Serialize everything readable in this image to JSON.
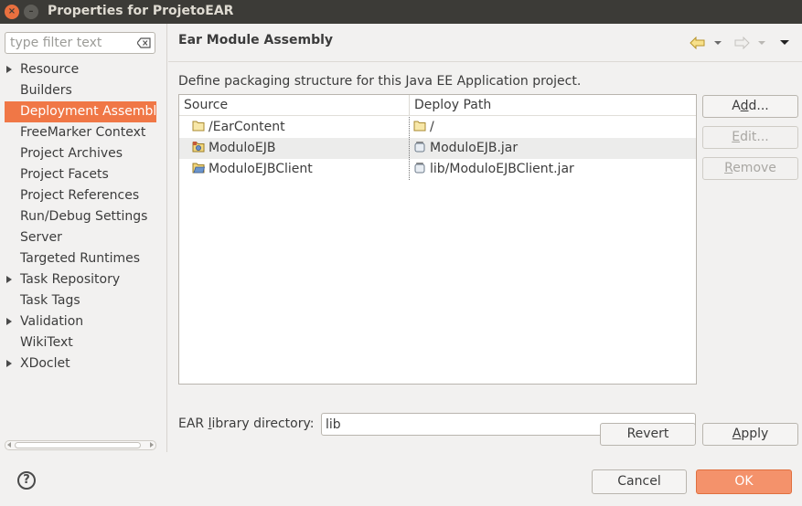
{
  "window": {
    "title": "Properties for ProjetoEAR",
    "close_glyph": "×",
    "other_glyph": "–"
  },
  "filter": {
    "placeholder": "type filter text"
  },
  "tree": [
    {
      "label": "Resource",
      "expandable": true,
      "selected": false
    },
    {
      "label": "Builders",
      "expandable": false,
      "selected": false
    },
    {
      "label": "Deployment Assembly",
      "expandable": false,
      "selected": true
    },
    {
      "label": "FreeMarker Context",
      "expandable": false,
      "selected": false
    },
    {
      "label": "Project Archives",
      "expandable": false,
      "selected": false
    },
    {
      "label": "Project Facets",
      "expandable": false,
      "selected": false
    },
    {
      "label": "Project References",
      "expandable": false,
      "selected": false
    },
    {
      "label": "Run/Debug Settings",
      "expandable": false,
      "selected": false
    },
    {
      "label": "Server",
      "expandable": false,
      "selected": false
    },
    {
      "label": "Targeted Runtimes",
      "expandable": false,
      "selected": false
    },
    {
      "label": "Task Repository",
      "expandable": true,
      "selected": false
    },
    {
      "label": "Task Tags",
      "expandable": false,
      "selected": false
    },
    {
      "label": "Validation",
      "expandable": true,
      "selected": false
    },
    {
      "label": "WikiText",
      "expandable": false,
      "selected": false
    },
    {
      "label": "XDoclet",
      "expandable": true,
      "selected": false
    }
  ],
  "page": {
    "title": "Ear Module Assembly",
    "description": "Define packaging structure for this Java EE Application project.",
    "columns": {
      "source": "Source",
      "deploy_path": "Deploy Path"
    },
    "rows": [
      {
        "source": "/EarContent",
        "source_icon": "folder-icon",
        "deploy_path": "/",
        "deploy_icon": "folder-icon"
      },
      {
        "source": "ModuloEJB",
        "source_icon": "ejb-project-icon",
        "deploy_path": "ModuloEJB.jar",
        "deploy_icon": "jar-icon"
      },
      {
        "source": "ModuloEJBClient",
        "source_icon": "project-folder-icon",
        "deploy_path": "lib/ModuloEJBClient.jar",
        "deploy_icon": "jar-icon"
      }
    ],
    "buttons": {
      "add": {
        "pre": "A",
        "mn": "d",
        "post": "d..."
      },
      "edit": {
        "pre": "",
        "mn": "E",
        "post": "dit..."
      },
      "remove": {
        "pre": "",
        "mn": "R",
        "post": "emove"
      }
    },
    "library_directory": {
      "pre": "EAR ",
      "mn": "l",
      "post": "ibrary directory:",
      "value": "lib"
    },
    "revert": "Revert",
    "apply": {
      "pre": "",
      "mn": "A",
      "post": "pply"
    }
  },
  "dialog": {
    "help_glyph": "?",
    "cancel": "Cancel",
    "ok": "OK"
  },
  "colors": {
    "selection": "#f07746",
    "ok_button": "#f4926b",
    "titlebar": "#3c3b37"
  }
}
